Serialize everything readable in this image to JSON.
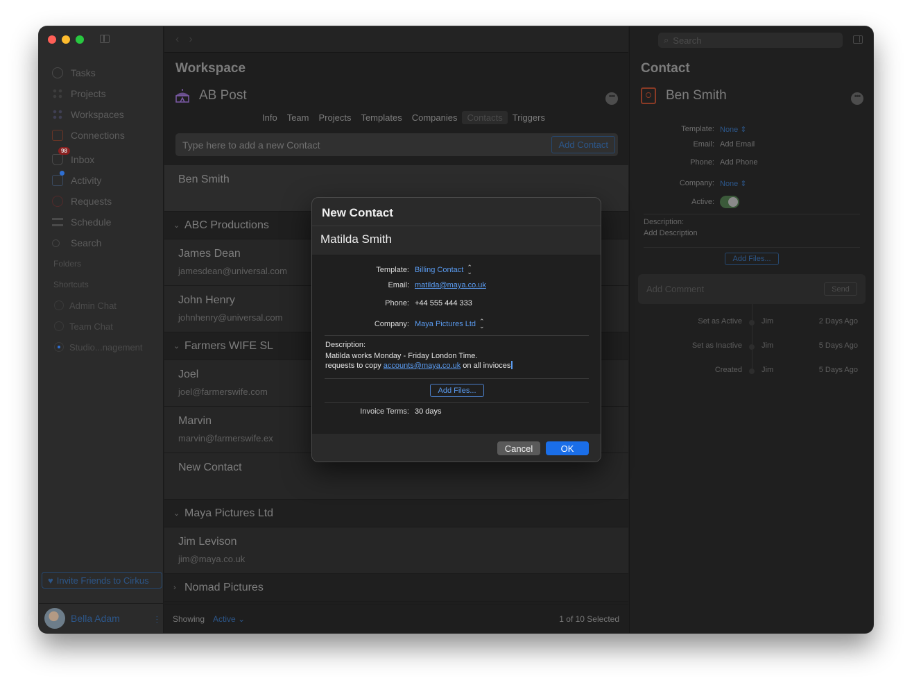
{
  "sidebar": {
    "nav": [
      {
        "label": "Tasks"
      },
      {
        "label": "Projects"
      },
      {
        "label": "Workspaces"
      },
      {
        "label": "Connections"
      },
      {
        "label": "Inbox",
        "badge": "98"
      },
      {
        "label": "Activity"
      },
      {
        "label": "Requests"
      },
      {
        "label": "Schedule"
      },
      {
        "label": "Search"
      }
    ],
    "folders_label": "Folders",
    "shortcuts_label": "Shortcuts",
    "chats": [
      {
        "label": "Admin Chat"
      },
      {
        "label": "Team Chat"
      },
      {
        "label": "Studio...nagement"
      }
    ],
    "invite_label": "Invite Friends to Cirkus",
    "user_name": "Bella Adam"
  },
  "workspace": {
    "title": "Workspace",
    "name": "AB Post",
    "tabs": [
      {
        "label": "Info"
      },
      {
        "label": "Team"
      },
      {
        "label": "Projects"
      },
      {
        "label": "Templates"
      },
      {
        "label": "Companies"
      },
      {
        "label": "Contacts"
      },
      {
        "label": "Triggers"
      }
    ],
    "add_placeholder": "Type here to add a new Contact",
    "add_button": "Add Contact",
    "first_contact": "Ben Smith",
    "groups": [
      {
        "name": "ABC Productions",
        "contacts": [
          {
            "name": "James Dean",
            "email": "jamesdean@universal.com"
          },
          {
            "name": "John Henry",
            "email": "johnhenry@universal.com"
          }
        ]
      },
      {
        "name": "Farmers WIFE SL",
        "contacts": [
          {
            "name": "Joel",
            "email": "joel@farmerswife.com"
          },
          {
            "name": "Marvin",
            "email": "marvin@farmerswife.ex"
          },
          {
            "name": "New Contact",
            "email": ""
          }
        ]
      },
      {
        "name": "Maya Pictures Ltd",
        "contacts": [
          {
            "name": "Jim Levison",
            "email": "jim@maya.co.uk"
          }
        ]
      },
      {
        "name": "Nomad Pictures",
        "contacts": []
      }
    ],
    "footer": {
      "showing_label": "Showing",
      "filter": "Active",
      "count": "1 of 10 Selected"
    }
  },
  "contact_panel": {
    "search_placeholder": "Search",
    "title": "Contact",
    "name": "Ben Smith",
    "fields": {
      "template_label": "Template:",
      "template_value": "None",
      "email_label": "Email:",
      "email_value": "Add Email",
      "phone_label": "Phone:",
      "phone_value": "Add Phone",
      "company_label": "Company:",
      "company_value": "None",
      "active_label": "Active:"
    },
    "description_label": "Description:",
    "description_value": "Add Description",
    "add_files": "Add Files...",
    "comment_placeholder": "Add Comment",
    "send": "Send",
    "timeline": [
      {
        "action": "Set as Active",
        "user": "Jim",
        "time": "2 Days Ago"
      },
      {
        "action": "Set as Inactive",
        "user": "Jim",
        "time": "5 Days Ago"
      },
      {
        "action": "Created",
        "user": "Jim",
        "time": "5 Days Ago"
      }
    ]
  },
  "modal": {
    "title": "New Contact",
    "name_value": "Matilda Smith",
    "template_label": "Template:",
    "template_value": "Billing Contact",
    "email_label": "Email:",
    "email_value": "matilda@maya.co.uk",
    "phone_label": "Phone:",
    "phone_value": "+44 555 444 333",
    "company_label": "Company:",
    "company_value": "Maya Pictures Ltd",
    "description_label": "Description:",
    "description_line1": "Matilda works Monday - Friday London Time.",
    "description_line2_pre": "requests to copy",
    "description_line2_link": "accounts@maya.co.uk",
    "description_line2_post": "on all invioces",
    "add_files": "Add Files...",
    "invoice_terms_label": "Invoice Terms:",
    "invoice_terms_value": "30 days",
    "cancel": "Cancel",
    "ok": "OK"
  }
}
